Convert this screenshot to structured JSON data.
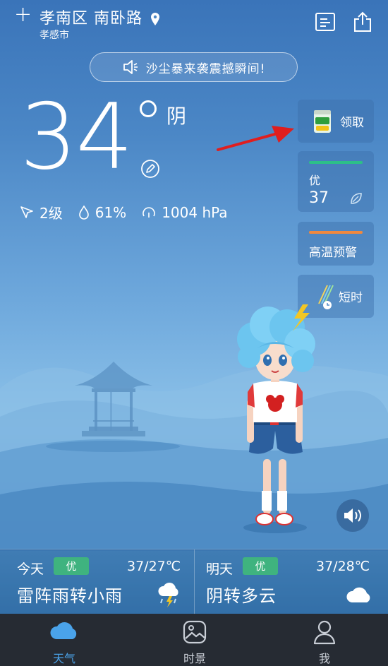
{
  "header": {
    "location": "孝南区 南卧路",
    "city": "孝感市"
  },
  "banner": {
    "text": "沙尘暴来袭震撼瞬间!"
  },
  "current": {
    "temperature": "34",
    "condition": "阴",
    "wind": "2级",
    "humidity": "61%",
    "pressure": "1004 hPa"
  },
  "side_cards": {
    "gift_label": "领取",
    "aqi_label": "优",
    "aqi_value": "37",
    "aqi_color": "#2dbf88",
    "alert_label": "高温预警",
    "alert_color": "#f0883e",
    "short_label": "短时"
  },
  "forecast": [
    {
      "day": "今天",
      "quality": "优",
      "range": "37/27℃",
      "desc": "雷阵雨转小雨",
      "icon": "thunderstorm-icon"
    },
    {
      "day": "明天",
      "quality": "优",
      "range": "37/28℃",
      "desc": "阴转多云",
      "icon": "cloud-icon"
    }
  ],
  "tabs": [
    {
      "label": "天气",
      "icon": "cloud-icon",
      "active": true
    },
    {
      "label": "时景",
      "icon": "picture-icon",
      "active": false
    },
    {
      "label": "我",
      "icon": "user-icon",
      "active": false
    }
  ],
  "colors": {
    "active_tab": "#4aa3ea",
    "tab_bg": "#262b33"
  }
}
